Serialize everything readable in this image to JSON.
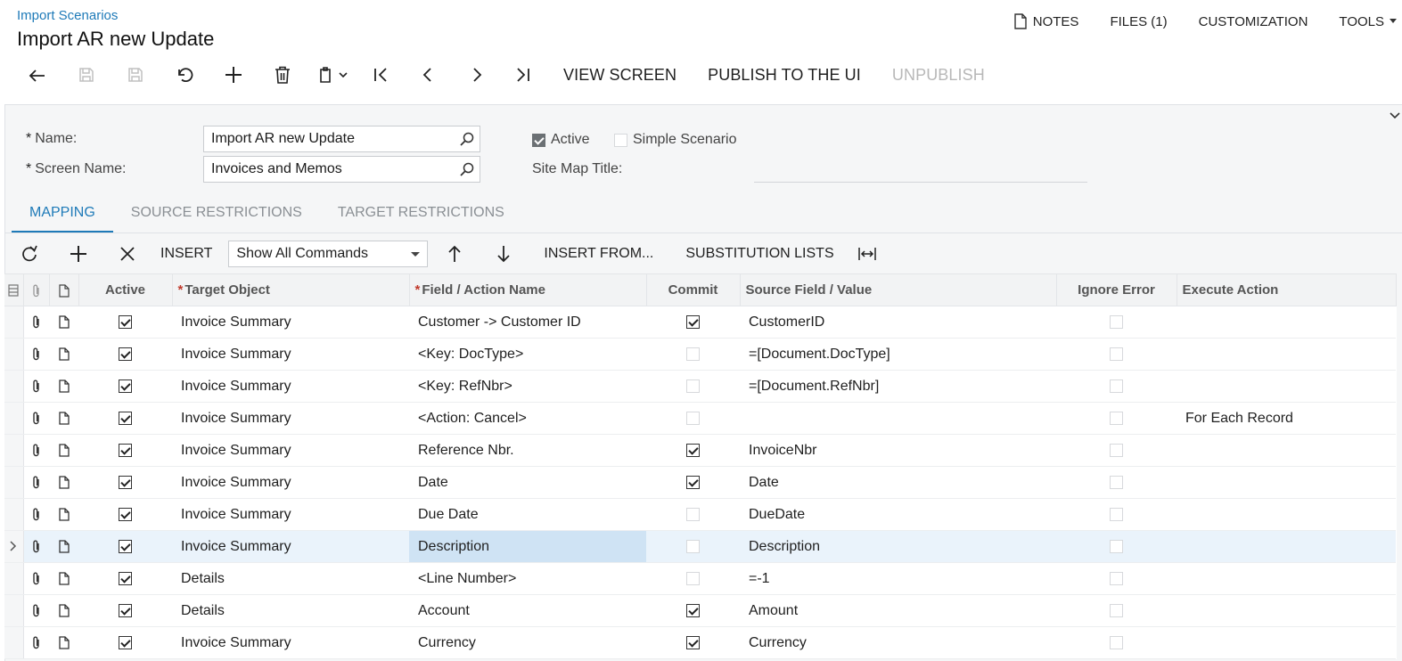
{
  "header": {
    "breadcrumb": "Import Scenarios",
    "title": "Import AR new Update"
  },
  "top_links": {
    "notes": "NOTES",
    "files": "FILES (1)",
    "customization": "CUSTOMIZATION",
    "tools": "TOOLS"
  },
  "toolbar": {
    "view_screen": "VIEW SCREEN",
    "publish": "PUBLISH TO THE UI",
    "unpublish": "UNPUBLISH"
  },
  "form": {
    "name_label": "Name:",
    "name_value": "Import AR new Update",
    "screen_label": "Screen Name:",
    "screen_value": "Invoices and Memos",
    "active_label": "Active",
    "active_checked": true,
    "simple_label": "Simple Scenario",
    "simple_checked": false,
    "sitemap_label": "Site Map Title:"
  },
  "tabs": [
    "MAPPING",
    "SOURCE RESTRICTIONS",
    "TARGET RESTRICTIONS"
  ],
  "grid_toolbar": {
    "insert": "INSERT",
    "show_select": "Show All Commands",
    "insert_from": "INSERT FROM...",
    "substitution": "SUBSTITUTION LISTS"
  },
  "grid": {
    "columns": [
      "Active",
      "Target Object",
      "Field / Action Name",
      "Commit",
      "Source Field / Value",
      "Ignore Error",
      "Execute Action"
    ],
    "rows": [
      {
        "active": true,
        "target": "Invoice Summary",
        "field": "Customer -> Customer ID",
        "commit": true,
        "source": "CustomerID",
        "ignore": false,
        "execute": ""
      },
      {
        "active": true,
        "target": "Invoice Summary",
        "field": "<Key: DocType>",
        "commit": false,
        "source": "=[Document.DocType]",
        "ignore": false,
        "execute": ""
      },
      {
        "active": true,
        "target": "Invoice Summary",
        "field": "<Key: RefNbr>",
        "commit": false,
        "source": "=[Document.RefNbr]",
        "ignore": false,
        "execute": ""
      },
      {
        "active": true,
        "target": "Invoice Summary",
        "field": "<Action: Cancel>",
        "commit": false,
        "source": "",
        "ignore": false,
        "execute": "For Each Record"
      },
      {
        "active": true,
        "target": "Invoice Summary",
        "field": "Reference Nbr.",
        "commit": true,
        "source": "InvoiceNbr",
        "ignore": false,
        "execute": ""
      },
      {
        "active": true,
        "target": "Invoice Summary",
        "field": "Date",
        "commit": true,
        "source": "Date",
        "ignore": false,
        "execute": ""
      },
      {
        "active": true,
        "target": "Invoice Summary",
        "field": "Due Date",
        "commit": false,
        "source": "DueDate",
        "ignore": false,
        "execute": ""
      },
      {
        "active": true,
        "target": "Invoice Summary",
        "field": "Description",
        "commit": false,
        "source": "Description",
        "ignore": false,
        "execute": "",
        "selected": true
      },
      {
        "active": true,
        "target": "Details",
        "field": "<Line Number>",
        "commit": false,
        "source": "=-1",
        "ignore": false,
        "execute": ""
      },
      {
        "active": true,
        "target": "Details",
        "field": "Account",
        "commit": true,
        "source": "Amount",
        "ignore": false,
        "execute": ""
      },
      {
        "active": true,
        "target": "Invoice Summary",
        "field": "Currency",
        "commit": true,
        "source": "Currency",
        "ignore": false,
        "execute": ""
      }
    ]
  }
}
